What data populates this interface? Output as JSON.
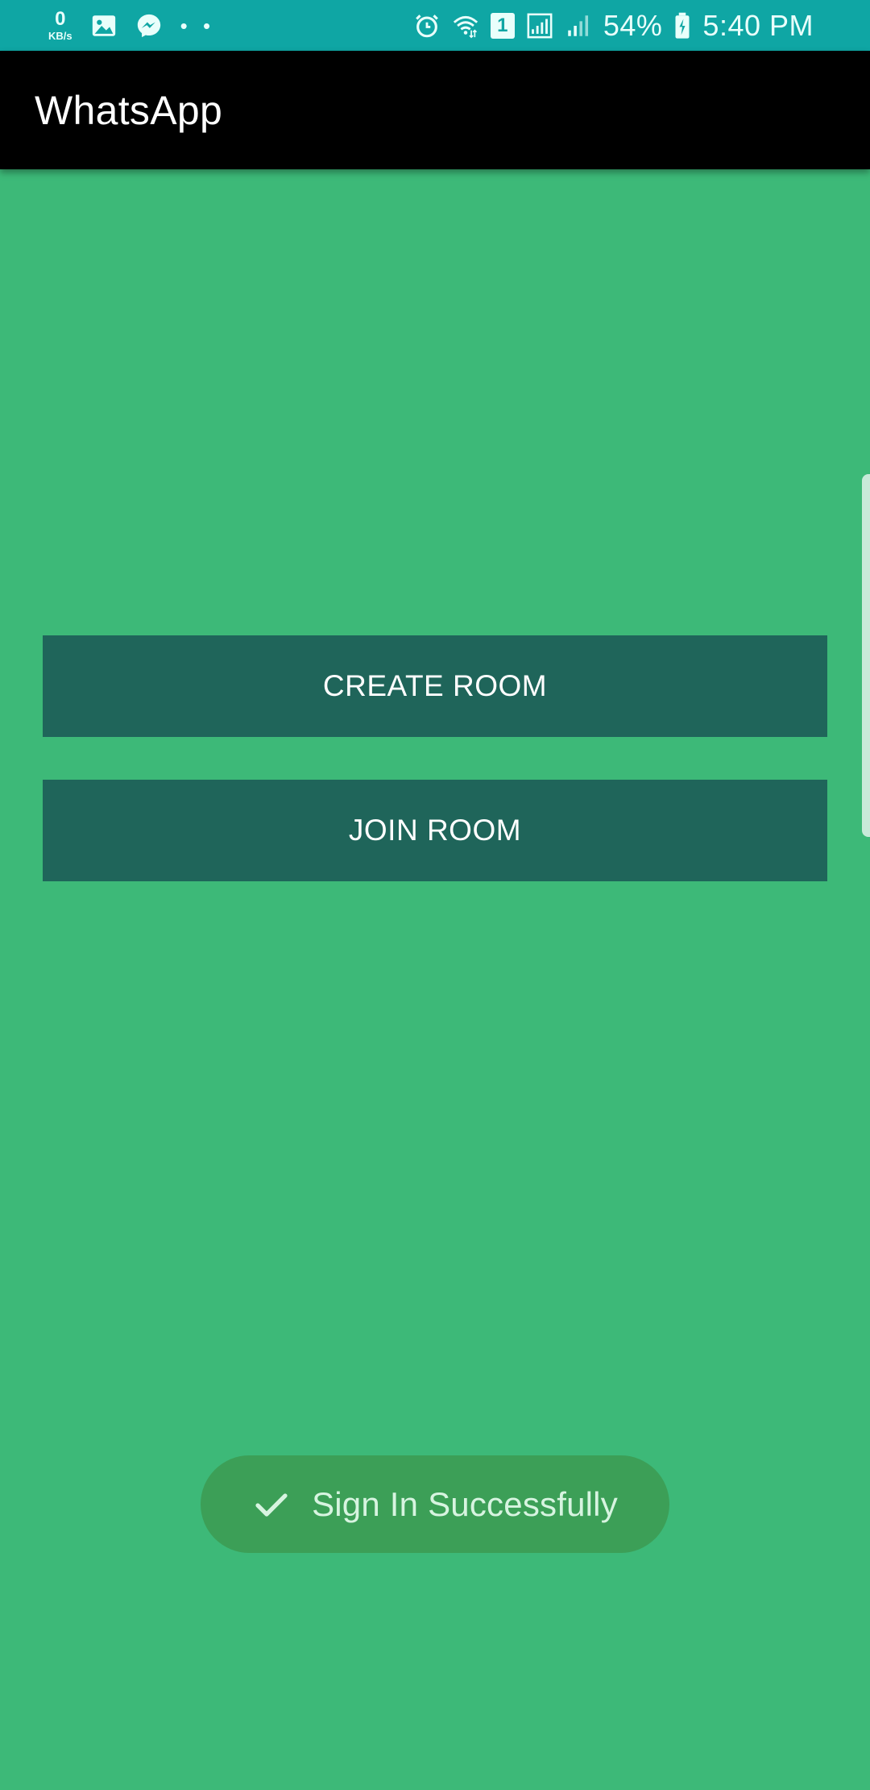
{
  "status_bar": {
    "net_speed_value": "0",
    "net_speed_unit": "KB/s",
    "left_icons": [
      "image-icon",
      "messenger-icon"
    ],
    "overflow_dots": "• •",
    "right_icons": [
      "alarm-icon",
      "wifi-icon",
      "sim-icon",
      "signal-icon",
      "signal-weak-icon",
      "battery-icon"
    ],
    "sim_label": "1",
    "battery_percent": "54%",
    "time": "5:40 PM"
  },
  "app_bar": {
    "title": "WhatsApp"
  },
  "main": {
    "create_room_label": "CREATE ROOM",
    "join_room_label": "JOIN ROOM"
  },
  "toast": {
    "icon": "checkmark-icon",
    "message": "Sign In Successfully"
  },
  "colors": {
    "background": "#3DB978",
    "status_bar": "#0FA6A4",
    "app_bar": "#000000",
    "button": "#1F655A",
    "toast": "#3C9F57"
  }
}
